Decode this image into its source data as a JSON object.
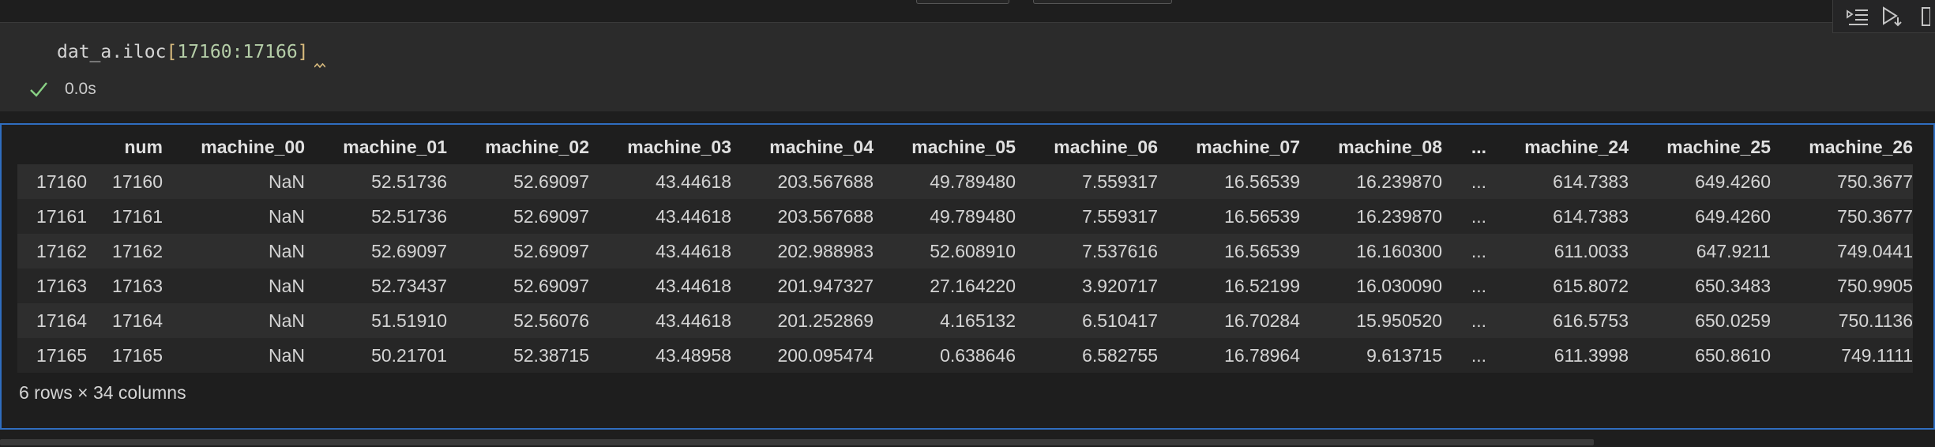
{
  "code_cell": {
    "code_prefix": "dat_a.iloc",
    "code_open": "[",
    "code_args": "17160:17166",
    "code_close": "]",
    "status_icon": "check-icon",
    "exec_time": "0.0s"
  },
  "toolbar": {
    "buttons": [
      "execute-above-icon",
      "run-below-icon",
      "more-icon"
    ]
  },
  "table": {
    "columns": [
      "",
      "num",
      "machine_00",
      "machine_01",
      "machine_02",
      "machine_03",
      "machine_04",
      "machine_05",
      "machine_06",
      "machine_07",
      "machine_08",
      "...",
      "machine_24",
      "machine_25",
      "machine_26"
    ],
    "rows": [
      [
        "17160",
        "17160",
        "NaN",
        "52.51736",
        "52.69097",
        "43.44618",
        "203.567688",
        "49.789480",
        "7.559317",
        "16.56539",
        "16.239870",
        "...",
        "614.7383",
        "649.4260",
        "750.3677"
      ],
      [
        "17161",
        "17161",
        "NaN",
        "52.51736",
        "52.69097",
        "43.44618",
        "203.567688",
        "49.789480",
        "7.559317",
        "16.56539",
        "16.239870",
        "...",
        "614.7383",
        "649.4260",
        "750.3677"
      ],
      [
        "17162",
        "17162",
        "NaN",
        "52.69097",
        "52.69097",
        "43.44618",
        "202.988983",
        "52.608910",
        "7.537616",
        "16.56539",
        "16.160300",
        "...",
        "611.0033",
        "647.9211",
        "749.0441"
      ],
      [
        "17163",
        "17163",
        "NaN",
        "52.73437",
        "52.69097",
        "43.44618",
        "201.947327",
        "27.164220",
        "3.920717",
        "16.52199",
        "16.030090",
        "...",
        "615.8072",
        "650.3483",
        "750.9905"
      ],
      [
        "17164",
        "17164",
        "NaN",
        "51.51910",
        "52.56076",
        "43.44618",
        "201.252869",
        "4.165132",
        "6.510417",
        "16.70284",
        "15.950520",
        "...",
        "616.5753",
        "650.0259",
        "750.1136"
      ],
      [
        "17165",
        "17165",
        "NaN",
        "50.21701",
        "52.38715",
        "43.48958",
        "200.095474",
        "0.638646",
        "6.582755",
        "16.78964",
        "9.613715",
        "...",
        "611.3998",
        "650.8610",
        "749.1111"
      ]
    ],
    "summary": "6 rows × 34 columns"
  },
  "colors": {
    "background": "#1e1e1e",
    "cell_background": "#2b2b2b",
    "focus_border": "#2f6dbf",
    "check_green": "#89d185"
  }
}
